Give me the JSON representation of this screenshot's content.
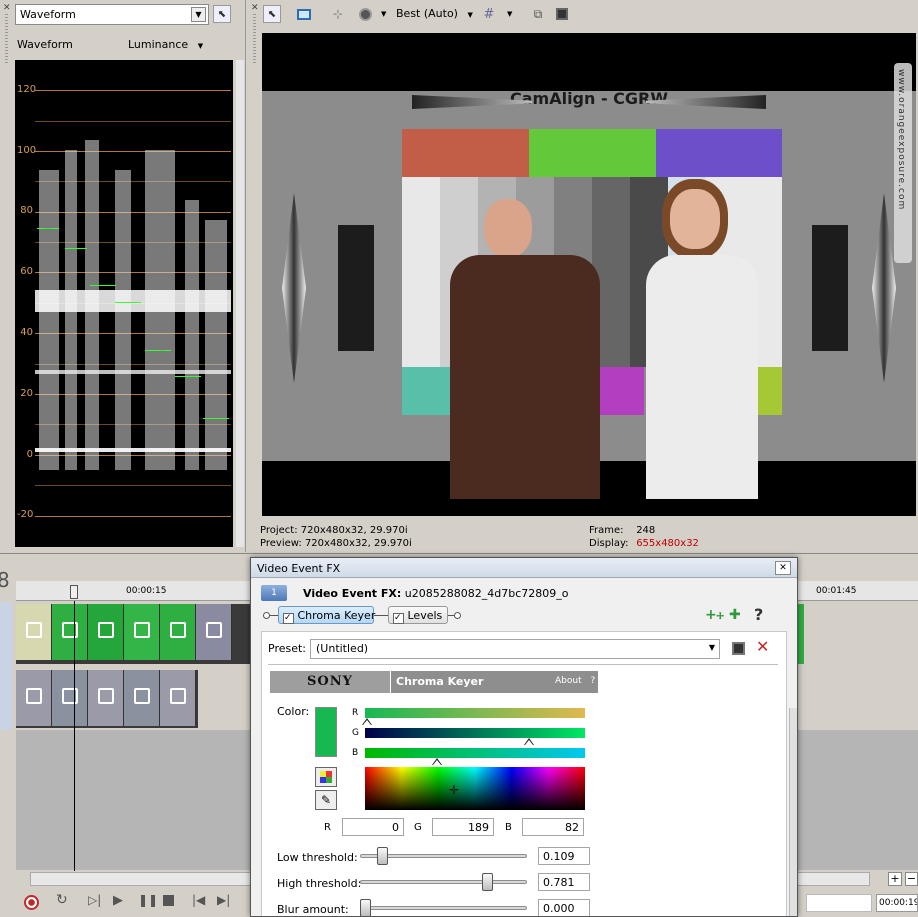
{
  "scopes": {
    "selector_value": "Waveform",
    "title": "Waveform",
    "mode": "Luminance",
    "scale_labels": [
      "120",
      "100",
      "80",
      "60",
      "40",
      "20",
      "0",
      "-20"
    ]
  },
  "preview": {
    "quality": "Best (Auto)",
    "chart_title": "CamAlign - CGRW",
    "watermark": "www.orangeexposure.com",
    "project_label": "Project:",
    "project_value": "720x480x32, 29.970i",
    "preview_label": "Preview:",
    "preview_value": "720x480x32, 29.970i",
    "frame_label": "Frame:",
    "frame_value": "248",
    "display_label": "Display:",
    "display_value": "655x480x32",
    "display_color": "#c00000"
  },
  "timeline": {
    "time_mark_1": "00:00:15",
    "time_mark_2": "00:01:45",
    "track_number": "8",
    "time_field": "00:00:19"
  },
  "fx": {
    "window_title": "Video Event FX",
    "track_badge": "1",
    "heading_label": "Video Event FX:",
    "heading_value": "u2085288082_4d7bc72809_o",
    "chain": [
      "Chroma Keyer",
      "Levels"
    ],
    "preset_label": "Preset:",
    "preset_value": "(Untitled)",
    "vendor_logo": "SONY",
    "plugin_name": "Chroma Keyer",
    "about_label": "About",
    "help_glyph": "?",
    "color_label": "Color:",
    "color_value": "#17b852",
    "channel_letters": [
      "R",
      "G",
      "B"
    ],
    "r_label": "R",
    "r_value": "0",
    "g_label": "G",
    "g_value": "189",
    "b_label": "B",
    "b_value": "82",
    "low_threshold_label": "Low threshold:",
    "low_threshold_value": "0.109",
    "low_threshold_level": 0.109,
    "high_threshold_label": "High threshold:",
    "high_threshold_value": "0.781",
    "high_threshold_level": 0.781,
    "blur_label": "Blur amount:",
    "blur_value": "0.000",
    "blur_level": 0.0
  }
}
